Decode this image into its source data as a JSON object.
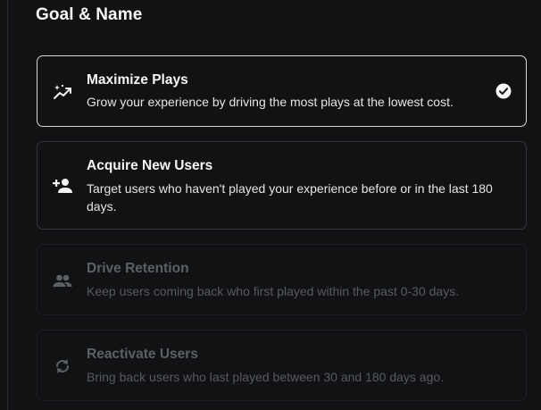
{
  "section": {
    "title": "Goal & Name"
  },
  "goals": [
    {
      "title": "Maximize Plays",
      "description": "Grow your experience by driving the most plays at the lowest cost.",
      "icon": "trending-up-sparkle-icon",
      "selected": true,
      "enabled": true
    },
    {
      "title": "Acquire New Users",
      "description": "Target users who haven't played your experience before or in the last 180 days.",
      "icon": "person-add-icon",
      "selected": false,
      "enabled": true
    },
    {
      "title": "Drive Retention",
      "description": "Keep users coming back who first played within the past 0-30 days.",
      "icon": "people-icon",
      "selected": false,
      "enabled": false
    },
    {
      "title": "Reactivate Users",
      "description": "Bring back users who last played between 30 and 180 days ago.",
      "icon": "refresh-arrows-icon",
      "selected": false,
      "enabled": false
    }
  ],
  "colors": {
    "background": "#111214",
    "selected_border": "#d6d7d9",
    "card_border": "#34363b",
    "disabled_text": "#5d6066"
  }
}
